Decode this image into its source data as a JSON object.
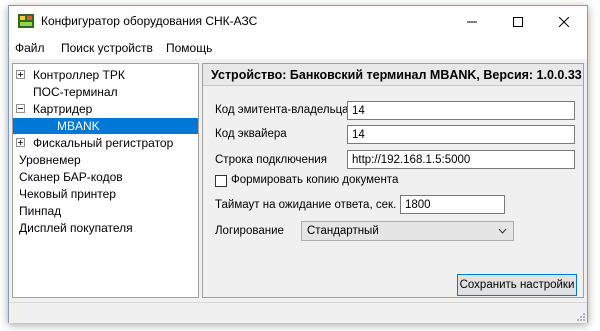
{
  "window": {
    "title": "Конфигуратор оборудования СНК-АЗС"
  },
  "menu": [
    "Файл",
    "Поиск устройств",
    "Помощь"
  ],
  "tree": [
    {
      "label": "Контроллер ТРК",
      "expander": "plus",
      "indent": 0
    },
    {
      "label": "ПОС-терминал",
      "expander": "none",
      "indent": 0
    },
    {
      "label": "Картридер",
      "expander": "minus",
      "indent": 0
    },
    {
      "label": "MBANK",
      "expander": "none",
      "indent": 1,
      "selected": true
    },
    {
      "label": "Фискальный регистратор",
      "expander": "plus",
      "indent": 0
    },
    {
      "label": "Уровнемер",
      "expander": "none",
      "indent": 0
    },
    {
      "label": "Сканер БАР-кодов",
      "expander": "none",
      "indent": 0
    },
    {
      "label": "Чековый принтер",
      "expander": "none",
      "indent": 0
    },
    {
      "label": "Пинпад",
      "expander": "none",
      "indent": 0
    },
    {
      "label": "Дисплей покупателя",
      "expander": "none",
      "indent": 0
    }
  ],
  "panel": {
    "header": "Устройство: Банковский терминал MBANK, Версия: 1.0.0.33",
    "issuer_label": "Код эмитента-владельца",
    "issuer_value": "14",
    "acquirer_label": "Код эквайера",
    "acquirer_value": "14",
    "connection_label": "Строка подключения",
    "connection_value": "http://192.168.1.5:5000",
    "copy_doc_label": "Формировать копию документа",
    "copy_doc_checked": false,
    "timeout_label": "Таймаут на ожидание ответа, сек.",
    "timeout_value": "1800",
    "logging_label": "Логирование",
    "logging_value": "Стандартный",
    "save_label": "Сохранить настройки"
  },
  "colors": {
    "selection": "#0078d7",
    "accent": "#0078d7"
  }
}
